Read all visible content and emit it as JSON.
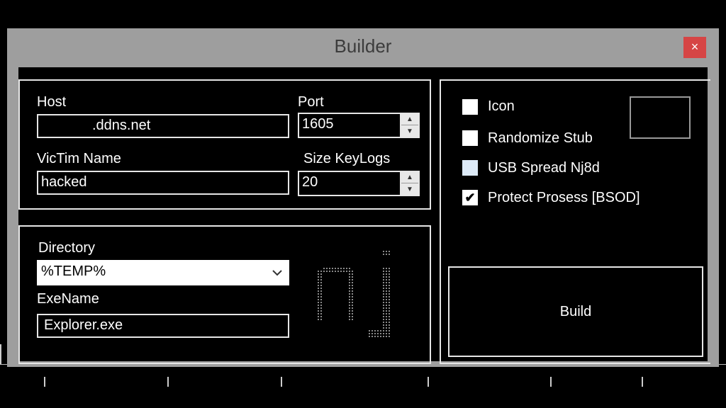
{
  "window": {
    "title": "Builder",
    "close_glyph": "×"
  },
  "connection": {
    "host_label": "Host",
    "host_value": ".ddns.net",
    "port_label": "Port",
    "port_value": "1605",
    "victim_label": "VicTim Name",
    "victim_value": "hacked",
    "keylogs_label": "Size KeyLogs",
    "keylogs_value": "20"
  },
  "install": {
    "directory_label": "Directory",
    "directory_value": "%TEMP%",
    "exename_label": "ExeName",
    "exename_value": "Explorer.exe",
    "logo_icon": "nj-ascii-logo"
  },
  "options": {
    "items": [
      {
        "label": "Icon",
        "checked": false
      },
      {
        "label": "Randomize Stub",
        "checked": false
      },
      {
        "label": "USB Spread Nj8d",
        "checked": false
      },
      {
        "label": "Protect Prosess [BSOD]",
        "checked": true
      }
    ],
    "check_glyph": "✔"
  },
  "build": {
    "label": "Build"
  },
  "colors": {
    "window_frame": "#9e9e9e",
    "close_red": "#d64545",
    "border": "#e6e6e6",
    "background": "#000000"
  }
}
